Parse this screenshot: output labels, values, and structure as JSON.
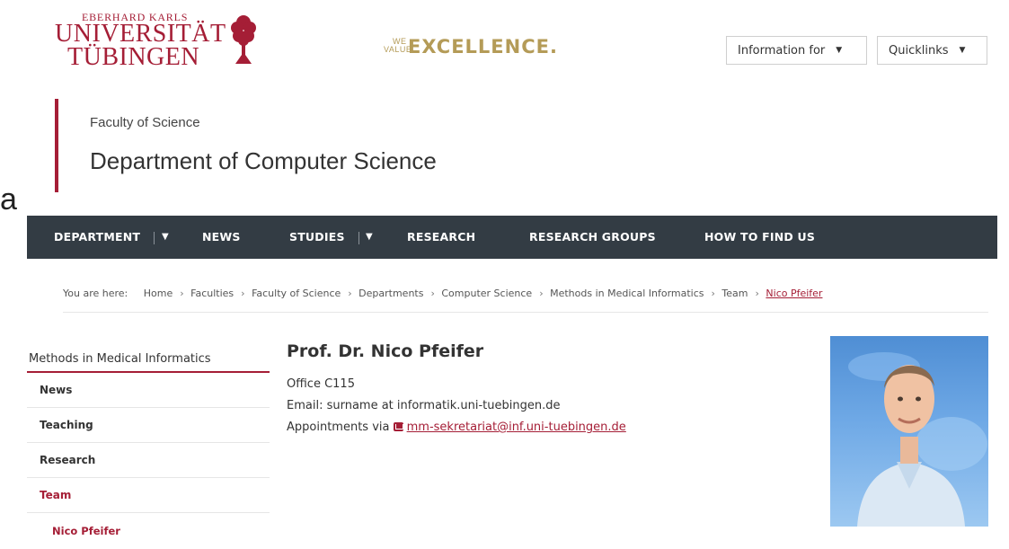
{
  "left_edge_char": "a",
  "logo": {
    "line1": "EBERHARD KARLS",
    "line2": "UNIVERSITÄT",
    "line3": "TÜBINGEN",
    "icon": "tree-icon"
  },
  "slogan": {
    "small1": "WE",
    "small2": "VALUE",
    "big": "EXCELLENCE."
  },
  "top_dropdowns": {
    "info_for": "Information for",
    "quicklinks": "Quicklinks"
  },
  "header": {
    "faculty": "Faculty of Science",
    "department": "Department of Computer Science"
  },
  "nav": {
    "items": [
      "DEPARTMENT",
      "NEWS",
      "STUDIES",
      "RESEARCH",
      "RESEARCH GROUPS",
      "HOW TO FIND US"
    ]
  },
  "breadcrumb": {
    "label": "You are here:",
    "items": [
      "Home",
      "Faculties",
      "Faculty of Science",
      "Departments",
      "Computer Science",
      "Methods in Medical Informatics",
      "Team",
      "Nico Pfeifer"
    ]
  },
  "sidebar": {
    "title": "Methods in Medical Informatics",
    "items": [
      "News",
      "Teaching",
      "Research",
      "Team"
    ],
    "sub_item": "Nico Pfeifer"
  },
  "profile": {
    "name": "Prof. Dr. Nico Pfeifer",
    "office": "Office C115",
    "email": "Email: surname at informatik.uni-tuebingen.de",
    "appointments_label": "Appointments via",
    "appointments_email": "mm-sekretariat@inf.uni-tuebingen.de"
  },
  "colors": {
    "accent": "#a51e36",
    "nav_bg": "#333c44",
    "gold": "#b49b57"
  }
}
